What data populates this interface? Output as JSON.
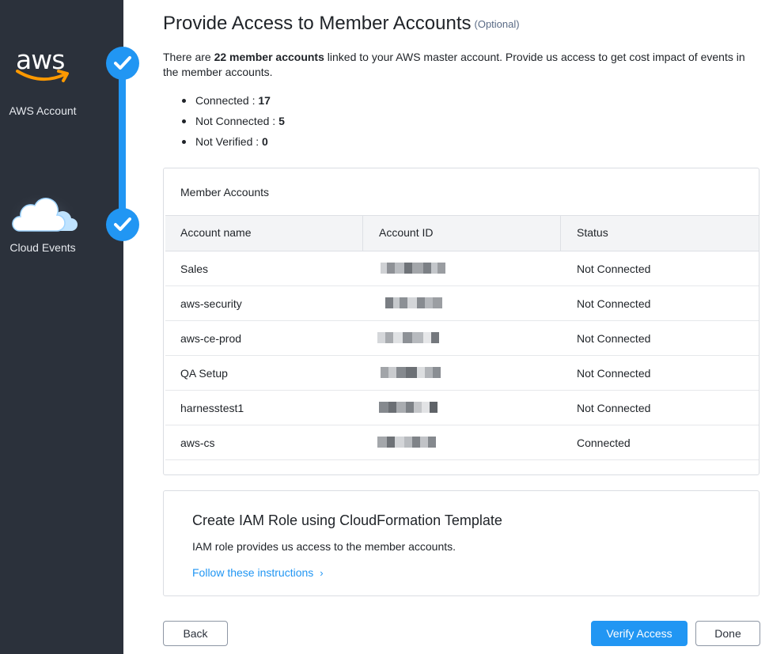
{
  "sidebar": {
    "steps": [
      {
        "logo": "aws",
        "label": "AWS Account",
        "status": "completed"
      },
      {
        "icon": "cloud-icon",
        "label": "Cloud Events",
        "status": "completed"
      }
    ],
    "accent_color": "#2196f3"
  },
  "header": {
    "title": "Provide Access to Member Accounts",
    "optional": "(Optional)"
  },
  "intro": {
    "prefix": "There are ",
    "count": "22 member accounts",
    "suffix": " linked to your AWS master account. Provide us access to get cost impact of events in the member accounts."
  },
  "stats": [
    {
      "label": "Connected : ",
      "value": "17"
    },
    {
      "label": "Not Connected : ",
      "value": "5"
    },
    {
      "label": "Not Verified : ",
      "value": "0"
    }
  ],
  "member_accounts": {
    "title": "Member Accounts",
    "columns": [
      "Account name",
      "Account ID",
      "Status"
    ],
    "rows": [
      {
        "name": "Sales",
        "status": "Not Connected"
      },
      {
        "name": "aws-security",
        "status": "Not Connected"
      },
      {
        "name": "aws-ce-prod",
        "status": "Not Connected"
      },
      {
        "name": "QA Setup",
        "status": "Not Connected"
      },
      {
        "name": "harnesstest1",
        "status": "Not Connected"
      },
      {
        "name": "aws-cs",
        "status": "Connected"
      }
    ]
  },
  "iam_card": {
    "title": "Create IAM Role using CloudFormation Template",
    "description": "IAM role provides us access to the member accounts.",
    "link": "Follow these instructions",
    "link_chevron": "›"
  },
  "footer": {
    "back": "Back",
    "verify": "Verify Access",
    "done": "Done"
  }
}
